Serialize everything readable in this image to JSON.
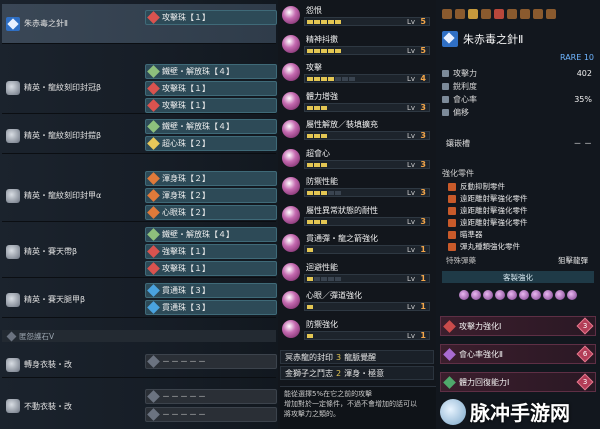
{
  "equipment": {
    "weapon": {
      "name": "朱赤毒之針Ⅱ",
      "decorations": [
        "攻擊珠【１】"
      ]
    },
    "armor": [
      {
        "name": "精英・龍紋刻印封冠β",
        "decorations": [
          "鐵壁・解放珠【４】",
          "攻擊珠【１】",
          "攻擊珠【１】"
        ]
      },
      {
        "name": "精英・龍紋刻印封鎧β",
        "decorations": [
          "鐵壁・解放珠【４】",
          "超心珠【２】"
        ]
      },
      {
        "name": "精英・龍紋刻印封甲α",
        "decorations": [
          "渾身珠【２】",
          "渾身珠【２】",
          "心眼珠【２】"
        ]
      },
      {
        "name": "精英・賽天帶β",
        "decorations": [
          "鐵壁・解放珠【４】",
          "強擊珠【１】",
          "攻擊珠【１】"
        ]
      },
      {
        "name": "精英・賽天腿甲β",
        "decorations": [
          "貫通珠【３】",
          "貫通珠【３】"
        ]
      }
    ],
    "kinsect_label": "匿怨護石Ⅴ",
    "layered": [
      {
        "name": "轉身衣裝・改",
        "decorations": [
          "－－－－－"
        ]
      },
      {
        "name": "不動衣裝・改",
        "decorations": [
          "－－－－－",
          "－－－－－"
        ]
      }
    ]
  },
  "skills": [
    {
      "name": "怨恨",
      "lv": "Lv",
      "level": 5,
      "max": 5
    },
    {
      "name": "精神抖擻",
      "lv": "Lv",
      "level": 5,
      "max": 5
    },
    {
      "name": "攻擊",
      "lv": "Lv",
      "level": 4,
      "max": 7
    },
    {
      "name": "體力增強",
      "lv": "Lv",
      "level": 3,
      "max": 3
    },
    {
      "name": "屬性解放／裝填擴充",
      "lv": "Lv",
      "level": 3,
      "max": 3
    },
    {
      "name": "超會心",
      "lv": "Lv",
      "level": 3,
      "max": 3
    },
    {
      "name": "防禦性能",
      "lv": "Lv",
      "level": 3,
      "max": 5
    },
    {
      "name": "屬性異常狀態的耐性",
      "lv": "Lv",
      "level": 3,
      "max": 3
    },
    {
      "name": "貫通彈・龍之箭強化",
      "lv": "Lv",
      "level": 1,
      "max": 1
    },
    {
      "name": "迴避性能",
      "lv": "Lv",
      "level": 1,
      "max": 5
    },
    {
      "name": "心眼／彈道強化",
      "lv": "Lv",
      "level": 1,
      "max": 1
    },
    {
      "name": "防禦強化",
      "lv": "Lv",
      "level": 1,
      "max": 1
    }
  ],
  "set_bonuses": [
    {
      "label": "冥赤龍的封印",
      "count": "3",
      "bonus": "龍脈覺醒"
    },
    {
      "label": "金獅子之鬥志",
      "count": "2",
      "bonus": "渾身・極意"
    }
  ],
  "tooltip": [
    "能從選擇5%在它之前的攻擊",
    "增加對於一定條件，不過不會增加的話可以",
    "將攻擊力之類的。"
  ],
  "status": {
    "title": "朱赤毒之針Ⅱ",
    "rare": "RARE 10",
    "stats": [
      {
        "label": "攻擊力",
        "value": "402"
      },
      {
        "label": "銳利度",
        "value": ""
      },
      {
        "label": "會心率",
        "value": "35%"
      },
      {
        "label": "偏移",
        "value": ""
      }
    ],
    "slots_label": "鑲嵌槽",
    "slots_value": "－ －",
    "parts_label": "強化零件",
    "parts": [
      "反動抑制零件",
      "遠距離射擊強化零件",
      "遠距離射擊強化零件",
      "遠距離射擊強化零件",
      "瞄準器",
      "彈丸種類強化零件"
    ],
    "ammo_label": "特殊彈藥",
    "ammo_value": "狙擊龍彈",
    "custom_label": "客製強化",
    "augments": [
      {
        "label": "攻擊力強化Ⅰ",
        "cost": "3"
      },
      {
        "label": "會心率強化Ⅱ",
        "cost": "6"
      },
      {
        "label": "體力回復能力Ⅰ",
        "cost": "3"
      }
    ]
  },
  "watermark": "脉冲手游网",
  "colors": {
    "decoration_fill": "#2d4a57",
    "skill_pip": "#e3c653",
    "level_number": "#f3a64a",
    "augment_fill": "#3b1e2d"
  }
}
